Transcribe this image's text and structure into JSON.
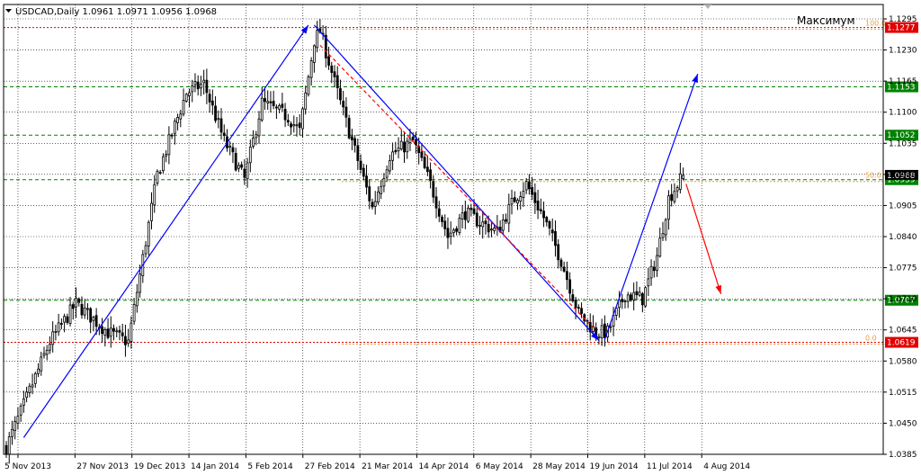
{
  "chart_data": {
    "type": "candlestick",
    "title": "USDCAD,Daily  1.0961 1.0971 1.0956 1.0968",
    "symbol": "USDCAD",
    "timeframe": "Daily",
    "ohlc_last": [
      1.0961,
      1.0971,
      1.0956,
      1.0968
    ],
    "annotation": "Максимум",
    "ylim": [
      1.0385,
      1.1295
    ],
    "y_ticks": [
      1.1295,
      1.123,
      1.1165,
      1.11,
      1.1035,
      1.097,
      1.0905,
      1.084,
      1.0775,
      1.071,
      1.0645,
      1.058,
      1.0515,
      1.045,
      1.0385
    ],
    "x_tick_labels": [
      "5 Nov 2013",
      "27 Nov 2013",
      "19 Dec 2013",
      "14 Jan 2014",
      "5 Feb 2014",
      "27 Feb 2014",
      "21 Mar 2014",
      "14 Apr 2014",
      "6 May 2014",
      "28 May 2014",
      "19 Jun 2014",
      "11 Jul 2014",
      "4 Aug 2014"
    ],
    "levels": [
      {
        "price": 1.1277,
        "label": "1.1277",
        "style": "red-dotted",
        "color": "#e00000",
        "fib": "100.0"
      },
      {
        "price": 1.1153,
        "label": "1.1153",
        "style": "green-dashed",
        "color": "#008000"
      },
      {
        "price": 1.1052,
        "label": "1.1052",
        "style": "green-dashed",
        "color": "#008000"
      },
      {
        "price": 1.0959,
        "label": "1.0959",
        "style": "green-dashed",
        "color": "#008000",
        "fib": "50.0"
      },
      {
        "price": 1.0707,
        "label": "1.0707",
        "style": "green-dashed",
        "color": "#008000"
      },
      {
        "price": 1.0619,
        "label": "1.0619",
        "style": "red-dotted",
        "color": "#e00000",
        "fib": "0.0"
      }
    ],
    "current_price_label": "1.0968",
    "waypoints": [
      {
        "d": 0,
        "p": 1.04
      },
      {
        "d": 15,
        "p": 1.062
      },
      {
        "d": 24,
        "p": 1.07
      },
      {
        "d": 35,
        "p": 1.064
      },
      {
        "d": 42,
        "p": 1.062
      },
      {
        "d": 52,
        "p": 1.097
      },
      {
        "d": 62,
        "p": 1.114
      },
      {
        "d": 68,
        "p": 1.116
      },
      {
        "d": 75,
        "p": 1.104
      },
      {
        "d": 82,
        "p": 1.096
      },
      {
        "d": 88,
        "p": 1.112
      },
      {
        "d": 97,
        "p": 1.109
      },
      {
        "d": 101,
        "p": 1.106
      },
      {
        "d": 106,
        "p": 1.125
      },
      {
        "d": 108,
        "p": 1.127
      },
      {
        "d": 115,
        "p": 1.112
      },
      {
        "d": 122,
        "p": 1.098
      },
      {
        "d": 126,
        "p": 1.09
      },
      {
        "d": 132,
        "p": 1.101
      },
      {
        "d": 140,
        "p": 1.104
      },
      {
        "d": 146,
        "p": 1.095
      },
      {
        "d": 152,
        "p": 1.084
      },
      {
        "d": 158,
        "p": 1.089
      },
      {
        "d": 163,
        "p": 1.087
      },
      {
        "d": 169,
        "p": 1.085
      },
      {
        "d": 175,
        "p": 1.092
      },
      {
        "d": 179,
        "p": 1.095
      },
      {
        "d": 185,
        "p": 1.088
      },
      {
        "d": 191,
        "p": 1.079
      },
      {
        "d": 197,
        "p": 1.068
      },
      {
        "d": 203,
        "p": 1.064
      },
      {
        "d": 207,
        "p": 1.064
      },
      {
        "d": 213,
        "p": 1.072
      },
      {
        "d": 219,
        "p": 1.071
      },
      {
        "d": 224,
        "p": 1.08
      },
      {
        "d": 228,
        "p": 1.092
      },
      {
        "d": 233,
        "p": 1.0968
      }
    ],
    "trend_lines": [
      {
        "from": [
          6,
          1.042
        ],
        "to": [
          104,
          1.1282
        ],
        "color": "#0000ff",
        "arrow": true
      },
      {
        "from": [
          106,
          1.1282
        ],
        "to": [
          204,
          1.0623
        ],
        "color": "#0000ff",
        "arrow": true
      },
      {
        "from": [
          108,
          1.124
        ],
        "to": [
          202,
          1.065
        ],
        "color": "#ff0000",
        "style": "dashed",
        "arrow": false
      },
      {
        "from": [
          206,
          1.0625
        ],
        "to": [
          238,
          1.118
        ],
        "color": "#0000ff",
        "arrow": true
      },
      {
        "from": [
          234,
          1.095
        ],
        "to": [
          246,
          1.072
        ],
        "color": "#ff0000",
        "arrow": true
      }
    ],
    "grid": true,
    "colors": {
      "background": "#ffffff",
      "grid": "#000000",
      "candle": "#000000",
      "level_green": "#008000",
      "level_red": "#e00000",
      "fib": "#e8a040",
      "trend_up": "#0000ff",
      "projection": "#ff0000"
    }
  }
}
